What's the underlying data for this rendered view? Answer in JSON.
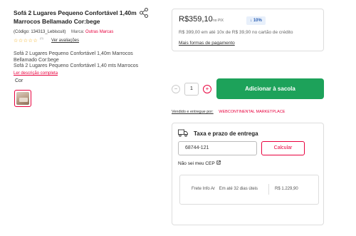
{
  "product": {
    "title": "Sofá 2 Lugares Pequeno Confortável 1,40m Marrocos Bellamado Cor:bege",
    "code": "(Código: 134313_Lebiscuit)",
    "brand_label": "Marca:",
    "brand_name": "Outras Marcas",
    "stars": "☆☆☆☆☆",
    "rating_count": "(0)",
    "reviews_link": "Ver avaliações",
    "description": "Sofá 2 Lugares Pequeno Confortável 1,40m Marrocos Bellamado Cor:bege\nSofá 2 Lugares Pequeno Confortável 1,40 mts Marrocos",
    "read_more": "Ler descrição completa",
    "color_label": "Cor"
  },
  "pricing": {
    "price": "R$359,10",
    "pix_label": "no PIX",
    "discount_badge": "↓ 10%",
    "installments": "R$ 399,00 em até 10x de R$ 39,90 no cartão de crédito",
    "more_payment": "Mais formas de pagamento"
  },
  "cart": {
    "quantity": "1",
    "minus": "−",
    "plus": "+",
    "add_button": "Adicionar à sacola"
  },
  "seller": {
    "label": "Vendido e entregue por:",
    "name": "WEBCONTINENTAL MARKETPLACE"
  },
  "shipping": {
    "title": "Taxa e prazo de entrega",
    "cep_value": "68744-121",
    "calc_button": "Calcular",
    "no_cep": "Não sei meu CEP",
    "option": {
      "name": "Frete Info Ar",
      "eta": "Em até 32 dias úteis",
      "price": "R$ 1.229,90"
    }
  },
  "icons": {
    "share": "share-icon",
    "truck": "truck-icon",
    "external": "external-link-icon"
  },
  "colors": {
    "accent_red": "#e8003d",
    "add_green": "#1da25a",
    "badge_blue": "#2b5fb3"
  }
}
